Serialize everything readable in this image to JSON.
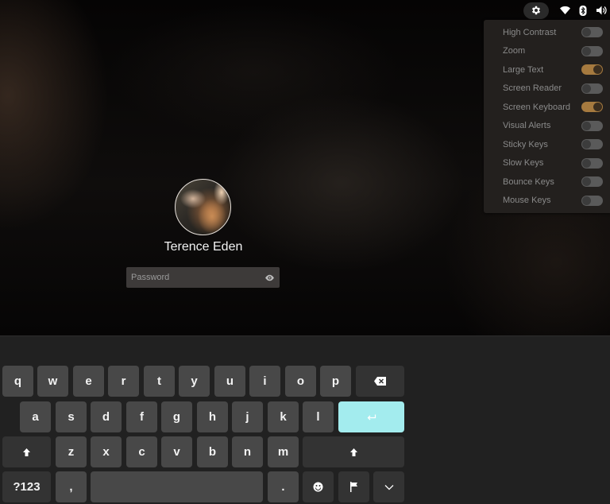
{
  "status_area": {
    "settings_icon": "gear-icon",
    "icons": [
      "wifi-icon",
      "bluetooth-icon",
      "volume-icon"
    ]
  },
  "accessibility_menu": {
    "items": [
      {
        "label": "High Contrast",
        "enabled": false
      },
      {
        "label": "Zoom",
        "enabled": false
      },
      {
        "label": "Large Text",
        "enabled": true
      },
      {
        "label": "Screen Reader",
        "enabled": false
      },
      {
        "label": "Screen Keyboard",
        "enabled": true
      },
      {
        "label": "Visual Alerts",
        "enabled": false
      },
      {
        "label": "Sticky Keys",
        "enabled": false
      },
      {
        "label": "Slow Keys",
        "enabled": false
      },
      {
        "label": "Bounce Keys",
        "enabled": false
      },
      {
        "label": "Mouse Keys",
        "enabled": false
      }
    ],
    "toggle_on_color": "#a67a3f"
  },
  "login": {
    "user_name": "Terence Eden",
    "avatar": "cat-photo",
    "password_placeholder": "Password",
    "password_value": "",
    "reveal_icon": "eye-icon"
  },
  "keyboard": {
    "enter_color": "#a3ecee",
    "rows": [
      [
        "q",
        "w",
        "e",
        "r",
        "t",
        "y",
        "u",
        "i",
        "o",
        "p",
        "backspace"
      ],
      [
        "a",
        "s",
        "d",
        "f",
        "g",
        "h",
        "j",
        "k",
        "l",
        "enter"
      ],
      [
        "shift",
        "z",
        "x",
        "c",
        "v",
        "b",
        "n",
        "m",
        "shift"
      ],
      [
        "?123",
        ",",
        "space",
        ".",
        "emoji",
        "flag",
        "hide"
      ]
    ],
    "labels": {
      "q": "q",
      "w": "w",
      "e": "e",
      "r": "r",
      "t": "t",
      "y": "y",
      "u": "u",
      "i": "i",
      "o": "o",
      "p": "p",
      "a": "a",
      "s": "s",
      "d": "d",
      "f": "f",
      "g": "g",
      "h": "h",
      "j": "j",
      "k": "k",
      "l": "l",
      "z": "z",
      "x": "x",
      "c": "c",
      "v": "v",
      "b": "b",
      "n": "n",
      "m": "m",
      "symbols": "?123",
      "comma": ",",
      "period": "."
    }
  }
}
